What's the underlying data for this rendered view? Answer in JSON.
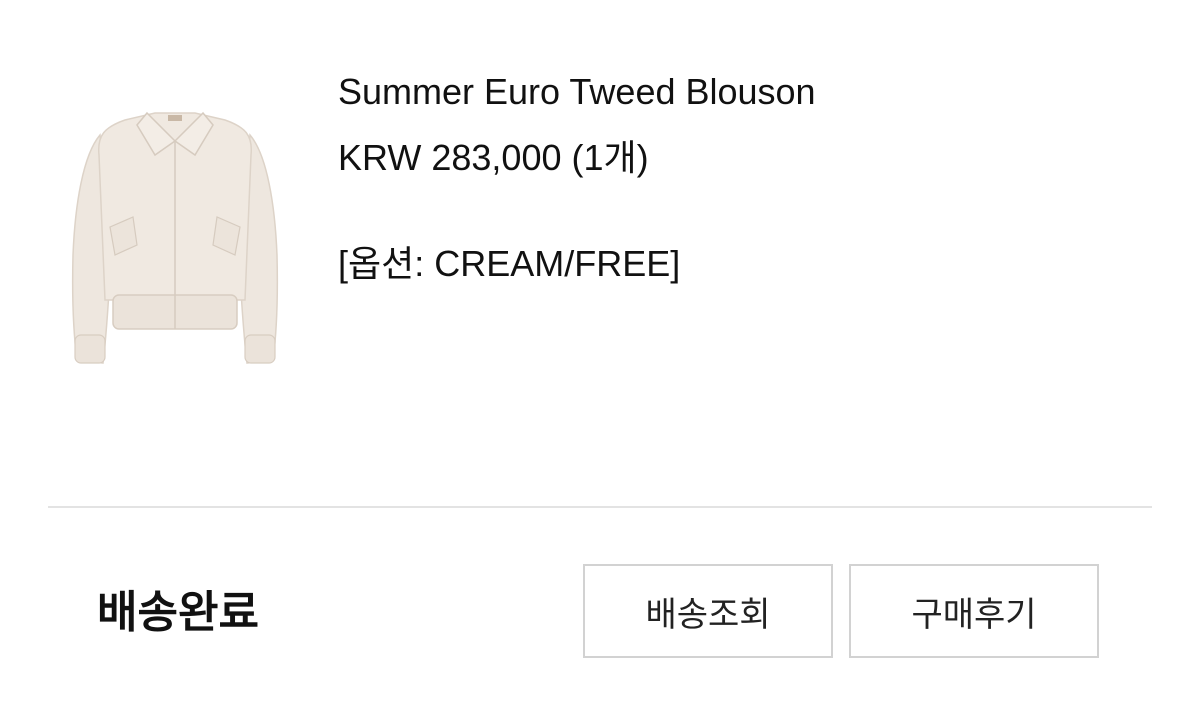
{
  "product": {
    "image_alt": "Summer Euro Tweed Blouson",
    "title": "Summer Euro Tweed Blouson",
    "currency": "KRW",
    "price": "283,000",
    "quantity": "(1개)",
    "option": "[옵션: CREAM/FREE]"
  },
  "order": {
    "status": "배송완료",
    "track_button_label": "배송조회",
    "review_button_label": "구매후기"
  },
  "colors": {
    "jacket": "#efe8e0",
    "jacket_shadow": "#ddd3c8",
    "divider": "#e3e3e3",
    "button_border": "#d2d2d2"
  }
}
